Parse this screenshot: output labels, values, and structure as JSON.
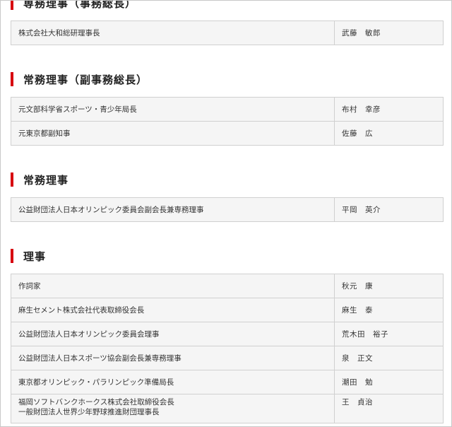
{
  "sections": [
    {
      "title": "専務理事（事務総長）",
      "rows": [
        {
          "org": "株式会社大和総研理事長",
          "name": "武藤　敏郎"
        }
      ]
    },
    {
      "title": "常務理事（副事務総長）",
      "rows": [
        {
          "org": "元文部科学省スポーツ・青少年局長",
          "name": "布村　幸彦"
        },
        {
          "org": "元東京都副知事",
          "name": "佐藤　広"
        }
      ]
    },
    {
      "title": "常務理事",
      "rows": [
        {
          "org": "公益財団法人日本オリンピック委員会副会長兼専務理事",
          "name": "平岡　英介"
        }
      ]
    },
    {
      "title": "理事",
      "rows": [
        {
          "org": "作詞家",
          "name": "秋元　康"
        },
        {
          "org": "麻生セメント株式会社代表取締役会長",
          "name": "麻生　泰"
        },
        {
          "org": "公益財団法人日本オリンピック委員会理事",
          "name": "荒木田　裕子"
        },
        {
          "org": "公益財団法人日本スポーツ協会副会長兼専務理事",
          "name": "泉　正文"
        },
        {
          "org": "東京都オリンピック・パラリンピック準備局長",
          "name": "潮田　勉"
        },
        {
          "org": "福岡ソフトバンクホークス株式会社取締役会長\n一般財団法人世界少年野球推進財団理事長",
          "name": "王　貞治"
        }
      ]
    }
  ]
}
